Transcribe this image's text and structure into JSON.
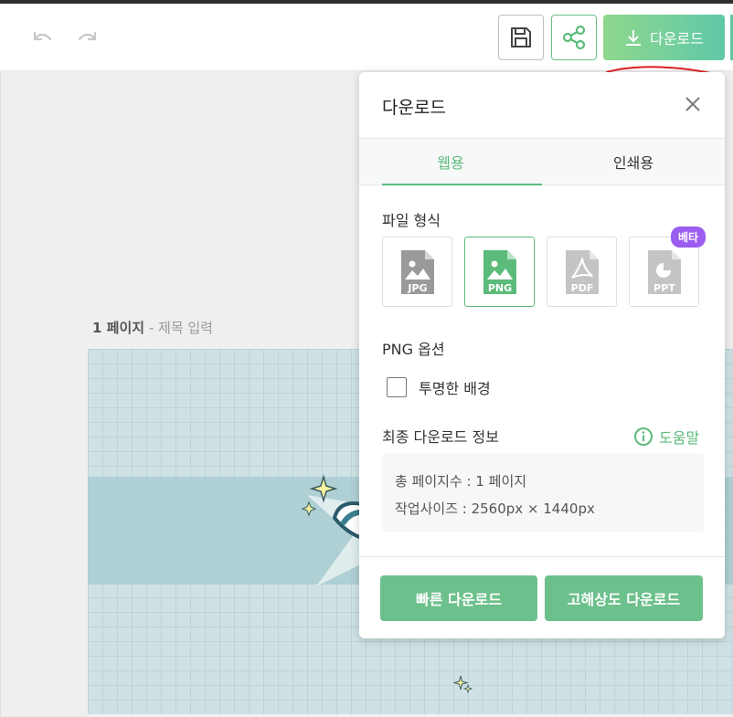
{
  "toolbar": {
    "download_label": "다운로드"
  },
  "page": {
    "number_label": "1 페이지",
    "separator": " - ",
    "title_placeholder": "제목 입력"
  },
  "panel": {
    "title": "다운로드",
    "tabs": [
      {
        "label": "웹용",
        "active": true
      },
      {
        "label": "인쇄용",
        "active": false
      }
    ],
    "file_format_label": "파일 형식",
    "formats": [
      {
        "label": "JPG",
        "selected": false
      },
      {
        "label": "PNG",
        "selected": true
      },
      {
        "label": "PDF",
        "selected": false
      },
      {
        "label": "PPT",
        "selected": false
      }
    ],
    "beta_badge": "베타",
    "options_label": "PNG 옵션",
    "transparent_bg_label": "투명한 배경",
    "transparent_bg_checked": false,
    "final_info_label": "최종 다운로드 정보",
    "help_label": "도움말",
    "total_pages": "총 페이지수 : 1 페이지",
    "work_size": "작업사이즈 : 2560px × 1440px",
    "fast_download_label": "빠른 다운로드",
    "hq_download_label": "고해상도 다운로드"
  },
  "colors": {
    "accent": "#5cbb7a",
    "button_green": "#6cc08b",
    "beta_purple": "#9b5cf0",
    "annotation_red": "#e02020"
  }
}
